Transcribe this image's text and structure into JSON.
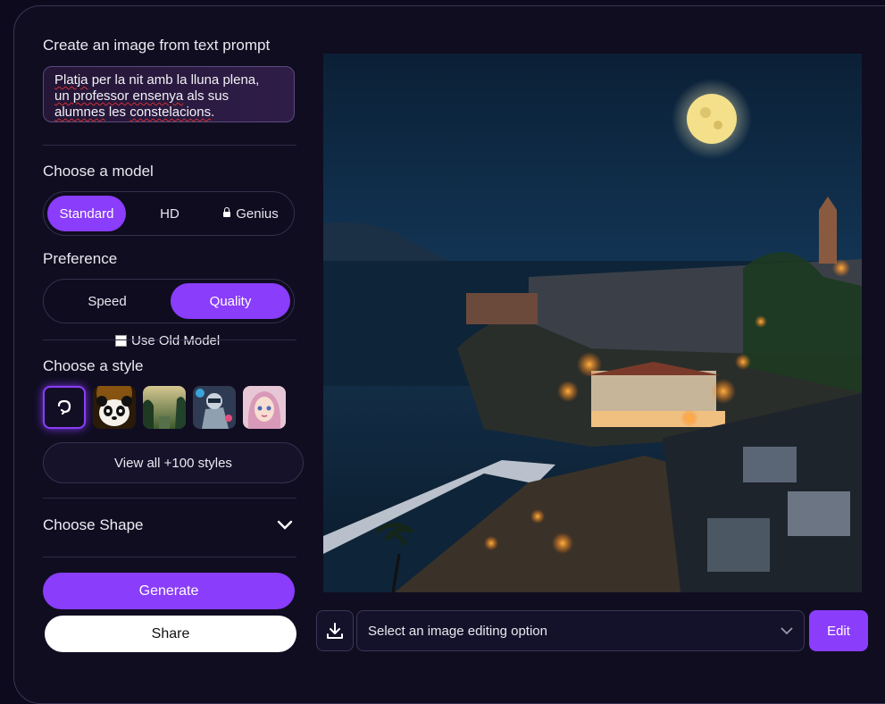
{
  "prompt_section": {
    "heading": "Create an image from text prompt",
    "text_parts": [
      "Platja",
      " per la nit amb la lluna plena, ",
      "un professor ensenya",
      " als sus ",
      "alumnes",
      " les ",
      "constelacions",
      "."
    ]
  },
  "model": {
    "heading": "Choose a model",
    "options": [
      "Standard",
      "HD",
      "Genius"
    ],
    "selected": "Standard"
  },
  "preference": {
    "heading": "Preference",
    "options": [
      "Speed",
      "Quality"
    ],
    "selected": "Quality"
  },
  "old_model": {
    "label": "Use Old Model",
    "checked": false
  },
  "style": {
    "heading": "Choose a style",
    "thumbnails": [
      "no-style-icon",
      "panda-style",
      "jungle-style",
      "robot-style",
      "anime-girl-style"
    ],
    "view_all": "View all +100 styles"
  },
  "shape": {
    "label": "Choose Shape"
  },
  "actions": {
    "generate": "Generate",
    "share": "Share"
  },
  "editing": {
    "placeholder": "Select an image editing option",
    "edit": "Edit"
  },
  "colors": {
    "accent": "#8a3dfb",
    "background": "#0c0a1c"
  }
}
